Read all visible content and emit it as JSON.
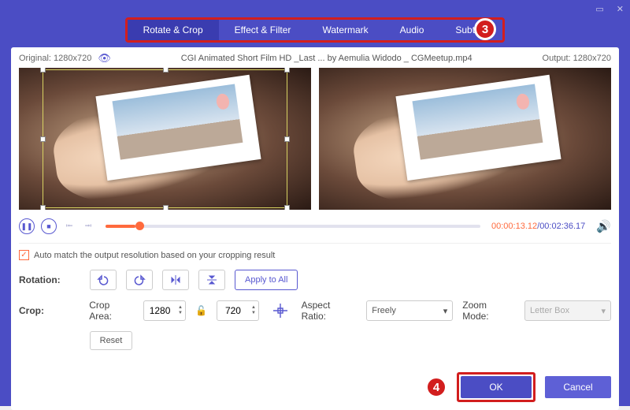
{
  "window": {
    "title": "CGI Animated Short Film HD _Last ... by Aemulia Widodo _ CGMeetup.mp4"
  },
  "tabs": {
    "items": [
      {
        "label": "Rotate & Crop"
      },
      {
        "label": "Effect & Filter"
      },
      {
        "label": "Watermark"
      },
      {
        "label": "Audio"
      },
      {
        "label": "Subtitle"
      }
    ]
  },
  "steps": {
    "three": "3",
    "four": "4"
  },
  "header": {
    "original": "Original: 1280x720",
    "output": "Output: 1280x720"
  },
  "playback": {
    "current": "00:00:13.12",
    "sep": "/",
    "duration": "00:02:36.17"
  },
  "automatch": {
    "label": "Auto match the output resolution based on your cropping result"
  },
  "rotation": {
    "label": "Rotation:",
    "apply_all": "Apply to All"
  },
  "crop": {
    "label": "Crop:",
    "area_label": "Crop Area:",
    "w": "1280",
    "h": "720",
    "aspect_label": "Aspect Ratio:",
    "aspect_value": "Freely",
    "zoom_label": "Zoom Mode:",
    "zoom_value": "Letter Box",
    "reset": "Reset"
  },
  "footer": {
    "ok": "OK",
    "cancel": "Cancel"
  }
}
